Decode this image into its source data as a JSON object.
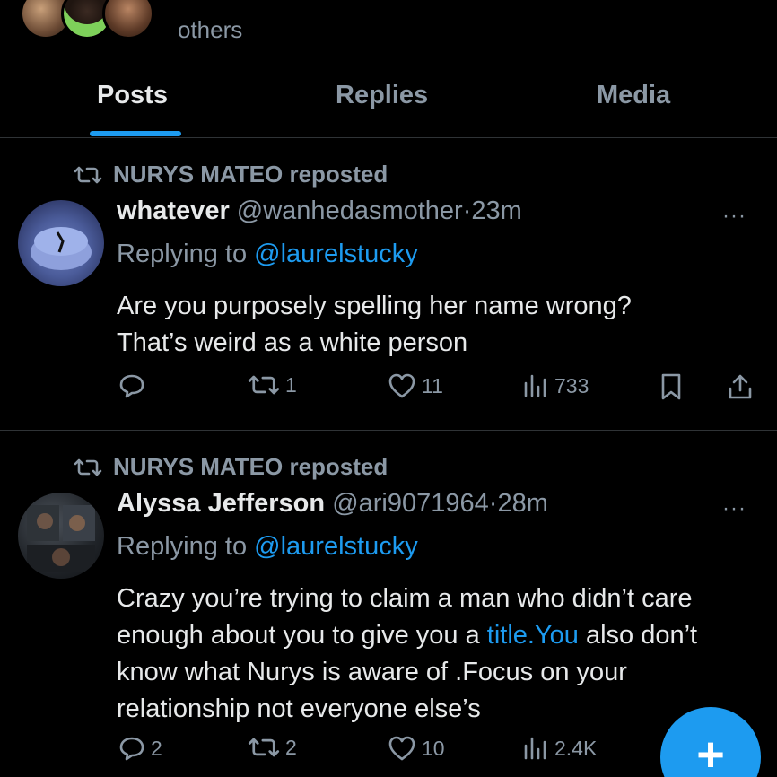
{
  "header": {
    "others_text": "others",
    "avatar_icons": [
      "user-avatar-1",
      "user-avatar-2",
      "user-avatar-3"
    ]
  },
  "tabs": [
    {
      "label": "Posts",
      "active": true
    },
    {
      "label": "Replies",
      "active": false
    },
    {
      "label": "Media",
      "active": false
    }
  ],
  "posts": [
    {
      "reposted_by": "NURYS MATEO reposted",
      "display_name": "whatever",
      "handle": "@wanhedasmother",
      "separator": "·",
      "time": "23m",
      "replying_label": "Replying to",
      "replying_to": "@laurelstucky",
      "text_line1": "Are you purposely spelling her name wrong?",
      "text_line2": "That’s weird as a white person",
      "replies": "",
      "reposts": "1",
      "likes": "11",
      "views": "733"
    },
    {
      "reposted_by": "NURYS MATEO reposted",
      "display_name": "Alyssa Jefferson",
      "handle": "@ari9071964",
      "separator": "·",
      "time": "28m",
      "replying_label": "Replying to",
      "replying_to": "@laurelstucky",
      "text_part1": "Crazy you’re trying to claim a man who didn’t care enough about you to give you a ",
      "text_link": "title.You",
      "text_part2": " also don’t know what Nurys is aware of .Focus on your relationship not everyone else’s",
      "replies": "2",
      "reposts": "2",
      "likes": "10",
      "views": "2.4K"
    }
  ],
  "more_label": "···",
  "fab_label": "+",
  "colors": {
    "background": "#000000",
    "accent": "#1d9bf0",
    "muted_text": "#8b98a5",
    "primary_text": "#e7e9ea",
    "divider": "#2f3336"
  }
}
